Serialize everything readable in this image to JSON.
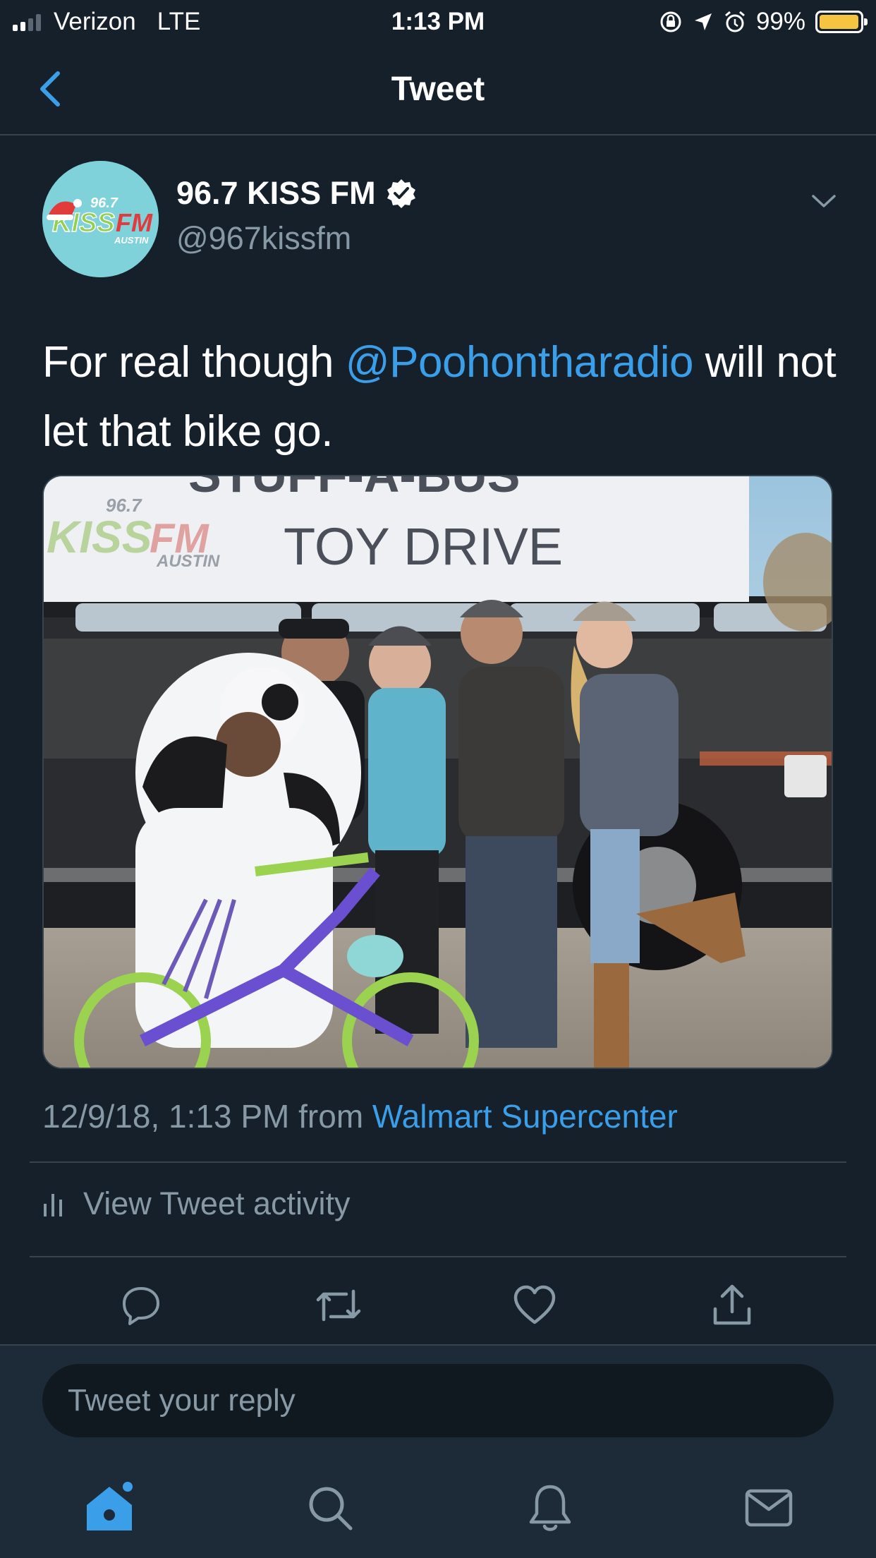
{
  "status_bar": {
    "carrier": "Verizon",
    "network": "LTE",
    "time": "1:13 PM",
    "battery": "99%",
    "battery_level": 0.99
  },
  "nav": {
    "title": "Tweet",
    "back_icon": "chevron-left-icon"
  },
  "tweet": {
    "author_name": "96.7 KISS FM",
    "author_handle": "@967kissfm",
    "verified": true,
    "avatar_logo": {
      "freq": "96.7",
      "kiss": "KISS",
      "fm": "FM",
      "city": "AUSTIN"
    },
    "text_before": "For real though ",
    "mention": "@Poohontharadio",
    "text_after": " will not let that bike go.",
    "image": {
      "banner_top": "STUFF-A-BUS",
      "banner_main": "TOY DRIVE",
      "banner_logo_freq": "96.7",
      "banner_logo_kiss": "KISS",
      "banner_logo_fm": "FM",
      "banner_logo_city": "AUSTIN"
    },
    "timestamp": "12/9/18, 1:13 PM",
    "from_label": "from",
    "source": "Walmart Supercenter",
    "activity_label": "View Tweet activity"
  },
  "actions": [
    {
      "name": "reply-icon"
    },
    {
      "name": "retweet-icon"
    },
    {
      "name": "like-icon"
    },
    {
      "name": "share-icon"
    }
  ],
  "reply": {
    "placeholder": "Tweet your reply"
  },
  "tabbar": [
    {
      "name": "home-icon",
      "active": true
    },
    {
      "name": "search-icon",
      "active": false
    },
    {
      "name": "notifications-icon",
      "active": false
    },
    {
      "name": "messages-icon",
      "active": false
    }
  ],
  "colors": {
    "background": "#15202b",
    "accent": "#3a9ee8",
    "secondary_text": "#8899a6",
    "divider": "#38444d"
  }
}
